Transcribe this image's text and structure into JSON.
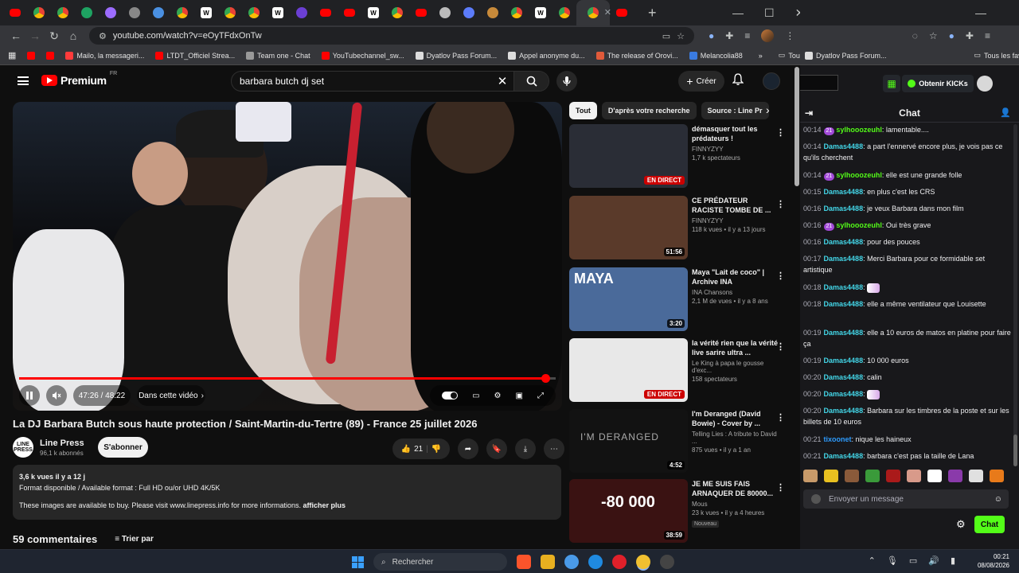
{
  "browser": {
    "tabs": [
      {
        "icon": "yt",
        "color": "#ff0000"
      },
      {
        "icon": "chrome",
        "color": "#8ab4f8"
      },
      {
        "icon": "chrome",
        "color": "#8ab4f8"
      },
      {
        "icon": "msg",
        "color": "#1ea362"
      },
      {
        "icon": "fig",
        "color": "#9c6cff"
      },
      {
        "icon": "pen",
        "color": "#888888"
      },
      {
        "icon": "shield",
        "color": "#4a90e2"
      },
      {
        "icon": "chrome",
        "color": "#8ab4f8"
      },
      {
        "icon": "W",
        "color": "#ffffff"
      },
      {
        "icon": "chrome",
        "color": "#8ab4f8"
      },
      {
        "icon": "chrome",
        "color": "#8ab4f8"
      },
      {
        "icon": "W",
        "color": "#ffffff"
      },
      {
        "icon": "purple",
        "color": "#6b3fd4"
      },
      {
        "icon": "yt",
        "color": "#ff0000"
      },
      {
        "icon": "yt",
        "color": "#ff0000"
      },
      {
        "icon": "W",
        "color": "#ffffff"
      },
      {
        "icon": "chrome",
        "color": "#8ab4f8"
      },
      {
        "icon": "yt",
        "color": "#ff0000"
      },
      {
        "icon": "gray",
        "color": "#bbbbbb"
      },
      {
        "icon": "ft",
        "color": "#5c7cfa"
      },
      {
        "icon": "book",
        "color": "#c88a3a"
      },
      {
        "icon": "chrome",
        "color": "#8ab4f8"
      },
      {
        "icon": "W",
        "color": "#ffffff"
      },
      {
        "icon": "chrome",
        "color": "#8ab4f8"
      },
      {
        "icon": "chrome",
        "color": "#8ab4f8",
        "active": true
      },
      {
        "icon": "yt",
        "color": "#ff0000"
      }
    ],
    "url": "youtube.com/watch?v=eOyTFdxOnTw",
    "bookmarks": [
      {
        "label": "",
        "color": "#ff0000"
      },
      {
        "label": "",
        "color": "#ff0000"
      },
      {
        "label": "Mailo, la messageri...",
        "color": "#ff3b3b"
      },
      {
        "label": "LTDT_Officiel Strea...",
        "color": "#ff0000"
      },
      {
        "label": "Team one - Chat",
        "color": "#999999"
      },
      {
        "label": "YouTubechannel_sw...",
        "color": "#ff0000"
      },
      {
        "label": "Dyatlov Pass Forum...",
        "color": "#dddddd"
      },
      {
        "label": "Appel anonyme du...",
        "color": "#dddddd"
      },
      {
        "label": "The release of Orovi...",
        "color": "#e05a3a"
      },
      {
        "label": "Melancolia88",
        "color": "#3a7be0"
      }
    ],
    "bookmarks_more": "»",
    "all_bookmarks": "Tous les favoris"
  },
  "youtube": {
    "premium_label": "Premium",
    "region": "FR",
    "search_query": "barbara butch dj set",
    "create_label": "Créer",
    "player": {
      "time": "47:26 / 48:22",
      "chapter": "Dans cette vidéo",
      "progress": 0.98
    },
    "video_title": "La DJ Barbara Butch sous haute protection / Saint-Martin-du-Tertre (89) - France 25 juillet 2026",
    "channel": {
      "avatar_text": "LINE PRESS",
      "name": "Line Press",
      "subs": "96,1 k abonnés"
    },
    "subscribe_label": "S'abonner",
    "likes": "21",
    "description": {
      "stats": "3,6 k vues  il y a 12 j",
      "line1": "Format disponible / Available format : Full HD ou/or UHD 4K/5K",
      "line2": "These images are available to buy. Please visit www.linepress.info for more informations.",
      "more": "afficher plus"
    },
    "comments": {
      "count": "59 commentaires",
      "sort": "Trier par"
    },
    "chips": [
      "Tout",
      "D'après votre recherche",
      "Source : Line Pr"
    ],
    "recommendations": [
      {
        "title": "démasquer tout les prédateurs !",
        "channel": "FINNYZYY",
        "meta": "1,7 k spectateurs",
        "live": "EN DIRECT",
        "duration": "",
        "badge": "",
        "thumb": "#2a2d36"
      },
      {
        "title": "CE PRÉDATEUR RACISTE TOMBE DE ...",
        "channel": "FINNYZYY",
        "meta": "118 k vues • il y a 13 jours",
        "live": "",
        "duration": "51:56",
        "badge": "",
        "thumb": "#5a3a2a"
      },
      {
        "title": "Maya \"Lait de coco\" | Archive INA",
        "channel": "INA Chansons",
        "meta": "2,1 M de vues • il y a 8 ans",
        "live": "",
        "duration": "3:20",
        "badge": "",
        "thumb": "#4a6a9a"
      },
      {
        "title": "la vérité rien que la vérité live sarire ultra ...",
        "channel": "Le King à papa le gousse d'exc...",
        "meta": "158 spectateurs",
        "live": "EN DIRECT",
        "duration": "",
        "badge": "",
        "thumb": "#e8e8e8"
      },
      {
        "title": "I'm Deranged (David Bowie) - Cover by ...",
        "channel": "Telling Lies : A tribute to David ...",
        "meta": "875 vues • il y a 1 an",
        "live": "",
        "duration": "4:52",
        "badge": "",
        "thumb": "#121212"
      },
      {
        "title": "JE ME SUIS FAIS ARNAQUER DE 80000...",
        "channel": "Mous",
        "meta": "23 k vues • il y a 4 heures",
        "live": "",
        "duration": "38:59",
        "badge": "Nouveau",
        "thumb": "#3a1212"
      }
    ],
    "thumb_overlay_maya": "MAYA",
    "thumb_overlay_deranged": "I'M DERANGED",
    "thumb_overlay_80000": "-80 000"
  },
  "right_window": {
    "bookmark_left": "Dyatlov Pass Forum...",
    "bookmark_right": "Tous les favoris",
    "kick_cta": "Obtenir KICKs",
    "chat_title": "Chat",
    "messages": [
      {
        "time": "00:14",
        "badge": "21",
        "user": "sylhooozeuhl",
        "ucls": "u1",
        "text": "lamentable...."
      },
      {
        "time": "00:14",
        "badge": "",
        "user": "Damas4488",
        "ucls": "u2",
        "text": "a part l'ennervé encore plus, je vois pas ce qu'ils cherchent"
      },
      {
        "time": "00:14",
        "badge": "21",
        "user": "sylhooozeuhl",
        "ucls": "u1",
        "text": "elle est une grande folle"
      },
      {
        "time": "00:15",
        "badge": "",
        "user": "Damas4488",
        "ucls": "u2",
        "text": "en plus c'est les CRS"
      },
      {
        "time": "00:16",
        "badge": "",
        "user": "Damas4488",
        "ucls": "u2",
        "text": "je veux Barbara dans mon film"
      },
      {
        "time": "00:16",
        "badge": "21",
        "user": "sylhooozeuhl",
        "ucls": "u1",
        "text": "Oui très grave"
      },
      {
        "time": "00:16",
        "badge": "",
        "user": "Damas4488",
        "ucls": "u2",
        "text": "pour des pouces"
      },
      {
        "time": "00:17",
        "badge": "",
        "user": "Damas4488",
        "ucls": "u2",
        "text": "Merci Barbara pour ce formidable set artistique"
      },
      {
        "time": "00:18",
        "badge": "",
        "user": "Damas4488",
        "ucls": "u2",
        "text": "",
        "emote": true
      },
      {
        "time": "00:18",
        "badge": "",
        "user": "Damas4488",
        "ucls": "u2",
        "text": "elle a même ventilateur que Louisette"
      },
      {
        "time": "00:19",
        "badge": "",
        "user": "Damas4488",
        "ucls": "u2",
        "text": "elle a 10 euros de matos en platine pour faire ça"
      },
      {
        "time": "00:19",
        "badge": "",
        "user": "Damas4488",
        "ucls": "u2",
        "text": "10 000 euros"
      },
      {
        "time": "00:20",
        "badge": "",
        "user": "Damas4488",
        "ucls": "u2",
        "text": "calin"
      },
      {
        "time": "00:20",
        "badge": "",
        "user": "Damas4488",
        "ucls": "u2",
        "text": "",
        "emote": true
      },
      {
        "time": "00:20",
        "badge": "",
        "user": "Damas4488",
        "ucls": "u2",
        "text": "Barbara sur les timbres de la poste et sur les billets de 10 euros"
      },
      {
        "time": "00:21",
        "badge": "",
        "user": "tixoonet",
        "ucls": "u3",
        "text": "nique les haineux"
      },
      {
        "time": "00:21",
        "badge": "",
        "user": "Damas4488",
        "ucls": "u2",
        "text": "barbara c'est pas la taille de Lana"
      }
    ],
    "emotes": [
      "#c89a6a",
      "#e8c020",
      "#8a5a3a",
      "#3a9a3a",
      "#aa1a1a",
      "#d89a8a",
      "#ffffff",
      "#8a3aaa",
      "#e0e0e0",
      "#e87a1a"
    ],
    "input_placeholder": "Envoyer un message",
    "send_label": "Chat"
  },
  "taskbar": {
    "search_placeholder": "Rechercher",
    "time": "00:21",
    "date": "08/08/2026"
  }
}
